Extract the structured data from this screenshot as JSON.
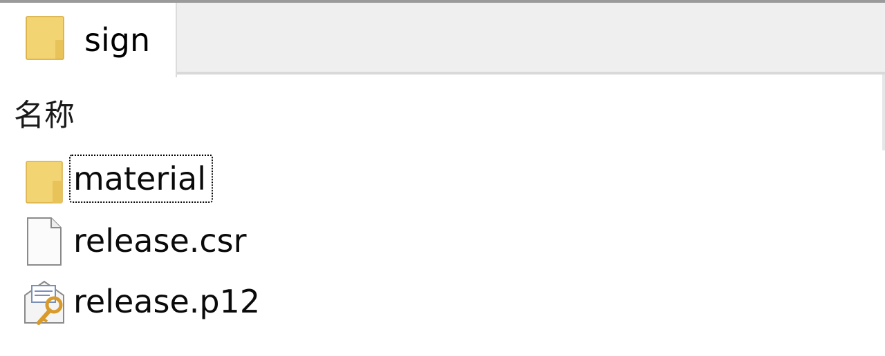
{
  "tab": {
    "title": "sign",
    "icon": "folder-icon"
  },
  "list": {
    "column_header": "名称",
    "items": [
      {
        "name": "material",
        "icon": "folder-icon",
        "type": "folder",
        "focused": true
      },
      {
        "name": "release.csr",
        "icon": "blank-file-icon",
        "type": "file",
        "focused": false
      },
      {
        "name": "release.p12",
        "icon": "certificate-key-icon",
        "type": "file",
        "focused": false
      }
    ]
  },
  "colors": {
    "folder": "#f3d473",
    "tab_strip": "#efefef",
    "certificate_key": "#d89a2a"
  }
}
